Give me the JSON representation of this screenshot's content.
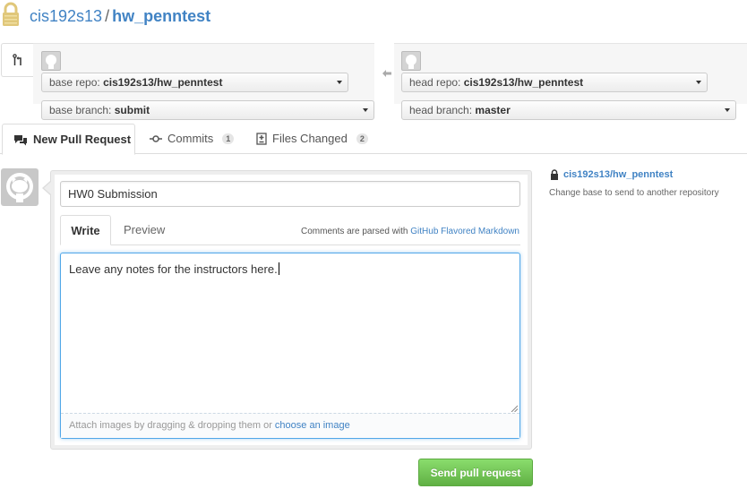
{
  "header": {
    "owner": "cis192s13",
    "separator": "/",
    "repo": "hw_penntest"
  },
  "range": {
    "base_repo_label": "base repo:",
    "base_repo_value": "cis192s13/hw_penntest",
    "base_branch_label": "base branch:",
    "base_branch_value": "submit",
    "head_repo_label": "head repo:",
    "head_repo_value": "cis192s13/hw_penntest",
    "head_branch_label": "head branch:",
    "head_branch_value": "master"
  },
  "tabs": [
    {
      "label": "New Pull Request",
      "icon": "comment-discussion-icon",
      "active": true
    },
    {
      "label": "Commits",
      "icon": "commit-icon",
      "count": "1"
    },
    {
      "label": "Files Changed",
      "icon": "diff-icon",
      "count": "2"
    }
  ],
  "form": {
    "title_value": "HW0 Submission",
    "write_tab": "Write",
    "preview_tab": "Preview",
    "md_note_prefix": "Comments are parsed with",
    "md_note_link": "GitHub Flavored Markdown",
    "body_value": "Leave any notes for the instructors here.",
    "drop_prefix": "Attach images by dragging & dropping them or",
    "drop_link": "choose an image",
    "submit_label": "Send pull request"
  },
  "sidebar": {
    "repo": "cis192s13/hw_penntest",
    "hint": "Change base to send to another repository"
  },
  "colors": {
    "link": "#4183c4",
    "submit": "#60b044",
    "focus": "#51a7e8",
    "lock": "#e0c77a"
  }
}
